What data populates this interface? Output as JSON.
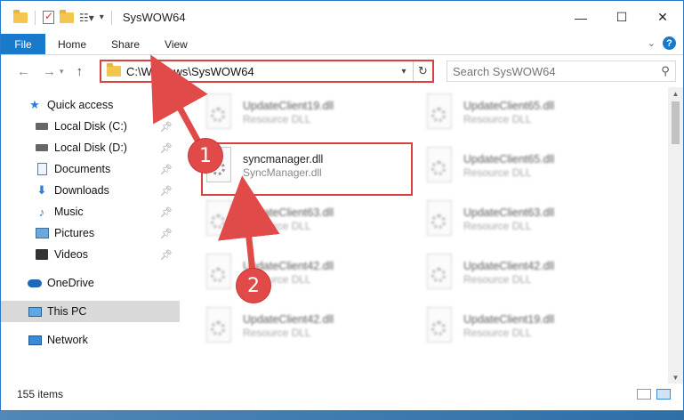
{
  "window": {
    "title": "SysWOW64",
    "controls": {
      "minimize": "—",
      "maximize": "☐",
      "close": "✕"
    }
  },
  "ribbon": {
    "tabs": [
      "File",
      "Home",
      "Share",
      "View"
    ],
    "expand_icon": "chevron-down-icon",
    "help": "?"
  },
  "address": {
    "path": "C:\\Windows\\SysWOW64",
    "search_placeholder": "Search SysWOW64"
  },
  "sidebar": {
    "quick_access": "Quick access",
    "items": [
      {
        "label": "Local Disk (C:)",
        "icon": "drive-icon",
        "pinned": true
      },
      {
        "label": "Local Disk (D:)",
        "icon": "drive-icon",
        "pinned": true
      },
      {
        "label": "Documents",
        "icon": "documents-icon",
        "pinned": true
      },
      {
        "label": "Downloads",
        "icon": "downloads-icon",
        "pinned": true
      },
      {
        "label": "Music",
        "icon": "music-icon",
        "pinned": true
      },
      {
        "label": "Pictures",
        "icon": "pictures-icon",
        "pinned": true
      },
      {
        "label": "Videos",
        "icon": "videos-icon",
        "pinned": true
      }
    ],
    "onedrive": "OneDrive",
    "this_pc": "This PC",
    "network": "Network"
  },
  "files": {
    "col1": [
      {
        "name": "UpdateClient19.dll",
        "desc": "Resource DLL"
      },
      {
        "name": "syncmanager.dll",
        "desc": "SyncManager.dll",
        "highlighted": true
      },
      {
        "name": "UpdateClient63.dll",
        "desc": "Resource DLL"
      },
      {
        "name": "UpdateClient42.dll",
        "desc": "Resource DLL"
      },
      {
        "name": "UpdateClient42.dll",
        "desc": "Resource DLL"
      }
    ],
    "col2": [
      {
        "name": "UpdateClient65.dll",
        "desc": "Resource DLL"
      },
      {
        "name": "UpdateClient65.dll",
        "desc": "Resource DLL"
      },
      {
        "name": "UpdateClient63.dll",
        "desc": "Resource DLL"
      },
      {
        "name": "UpdateClient42.dll",
        "desc": "Resource DLL"
      },
      {
        "name": "UpdateClient19.dll",
        "desc": "Resource DLL"
      }
    ]
  },
  "status": {
    "items_count": "155 items"
  },
  "callouts": [
    "1",
    "2"
  ],
  "colors": {
    "accent": "#1979ca",
    "highlight": "#d9413f",
    "callout": "#e04b49"
  }
}
